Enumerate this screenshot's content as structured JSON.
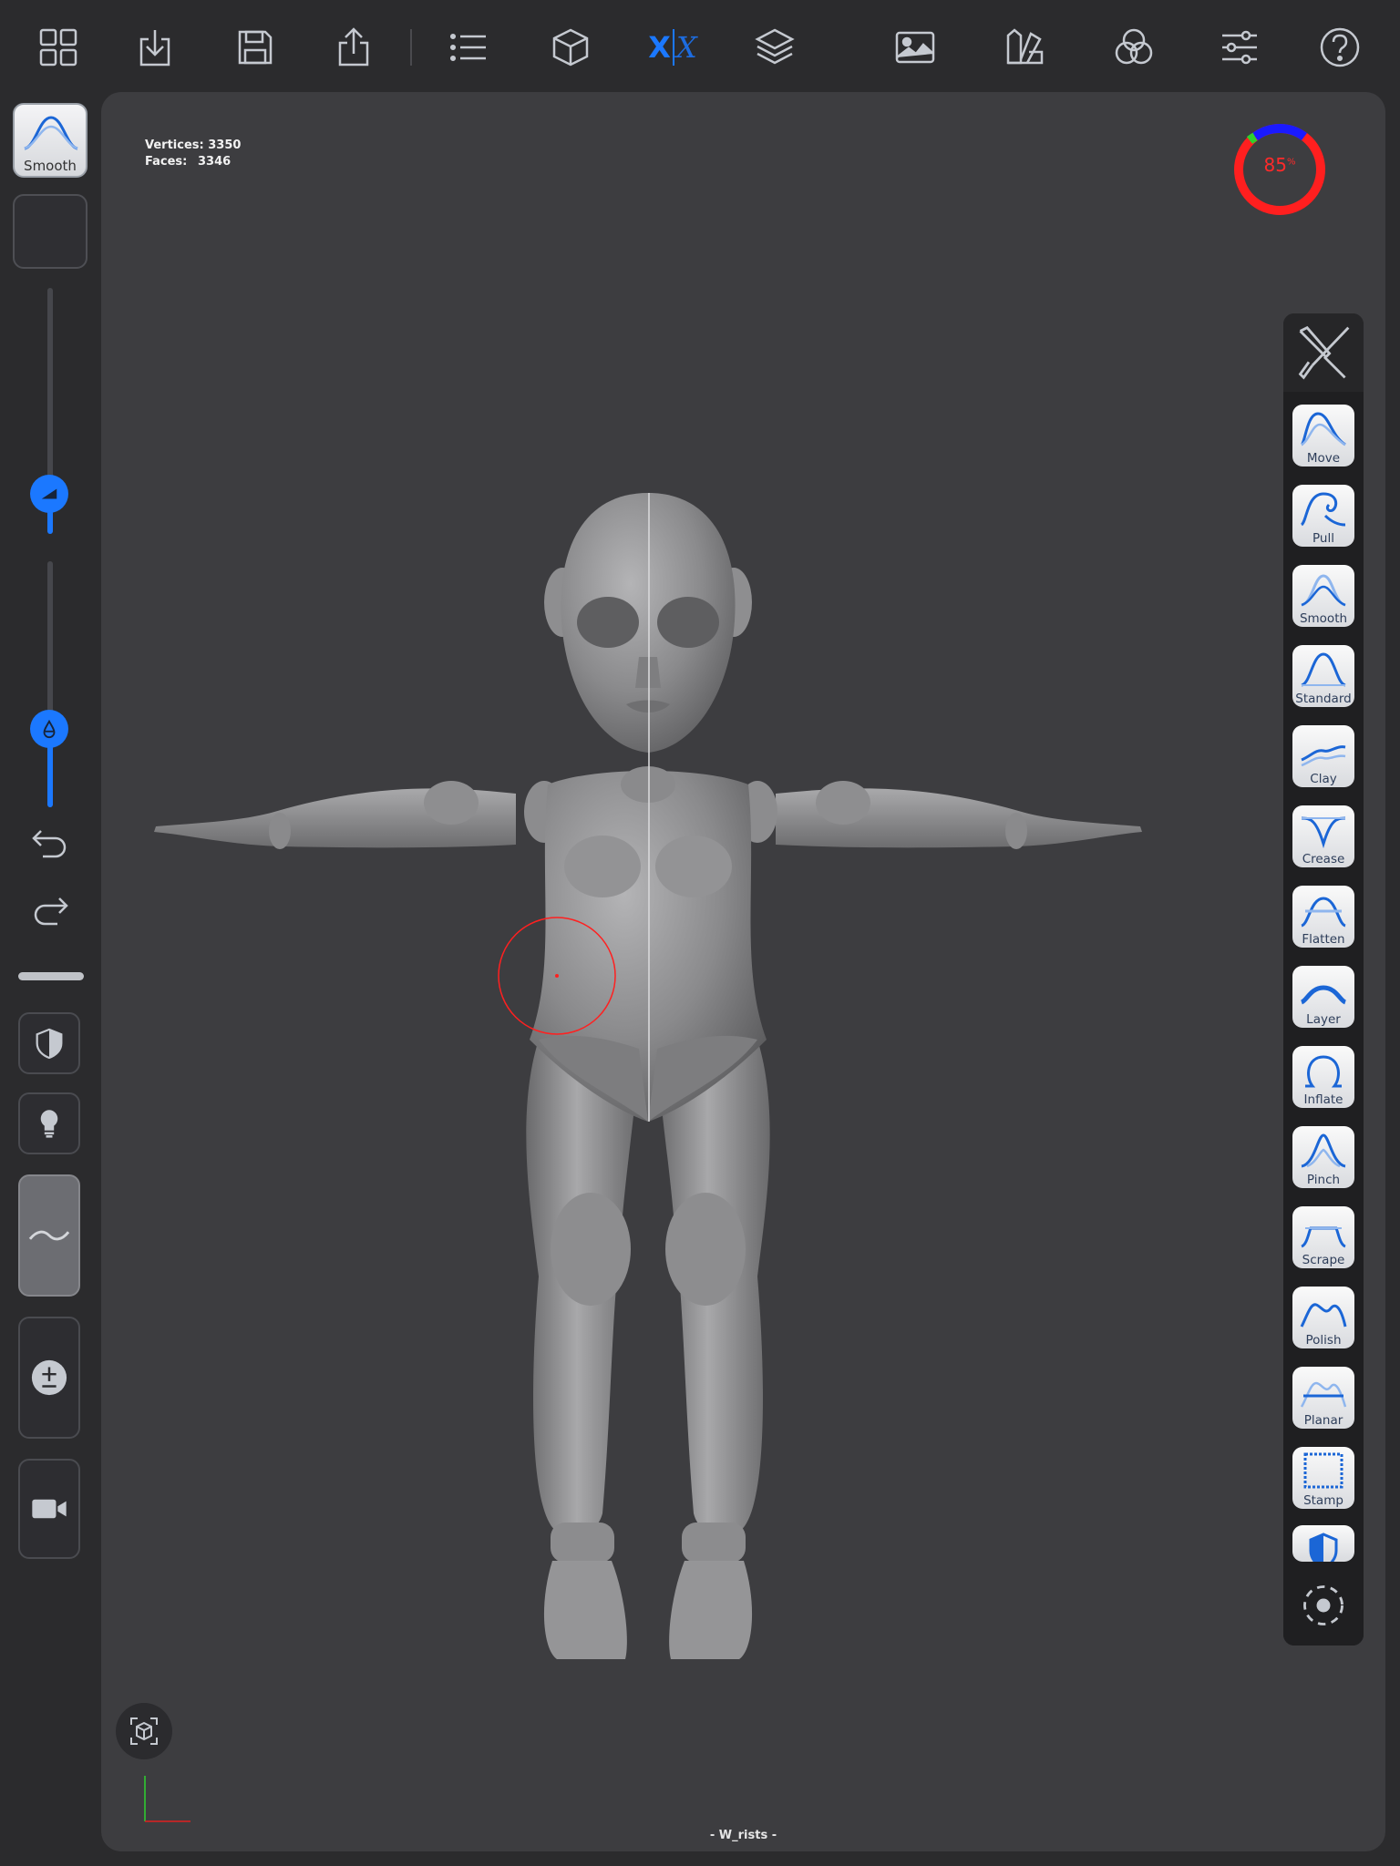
{
  "toolbar": {
    "icons": [
      "grid-icon",
      "import-icon",
      "save-icon",
      "share-icon",
      "list-icon",
      "cube-icon",
      "symmetry-icon",
      "layers-icon",
      "image-icon",
      "paint-icon",
      "material-icon",
      "settings-icon",
      "help-icon"
    ],
    "symmetry_left": "X",
    "symmetry_right": "X",
    "accent": "#1b78ff"
  },
  "stats": {
    "vertices_label": "Vertices:",
    "vertices_value": "3350",
    "faces_label": "Faces:",
    "faces_value": "3346"
  },
  "memory": {
    "value": "85",
    "unit": "%",
    "fraction": 0.85,
    "color": "#ff1f1f"
  },
  "left_panel": {
    "active_tool_label": "Smooth",
    "radius_fraction": 0.2,
    "intensity_fraction": 0.33,
    "icons": [
      "undo-icon",
      "redo-icon",
      "mask-icon",
      "light-icon",
      "stroke-icon",
      "plus-minus-icon",
      "camera-icon"
    ]
  },
  "tools": [
    {
      "label": "Move"
    },
    {
      "label": "Pull"
    },
    {
      "label": "Smooth"
    },
    {
      "label": "Standard"
    },
    {
      "label": "Clay"
    },
    {
      "label": "Crease"
    },
    {
      "label": "Flatten"
    },
    {
      "label": "Layer"
    },
    {
      "label": "Inflate"
    },
    {
      "label": "Pinch"
    },
    {
      "label": "Scrape"
    },
    {
      "label": "Polish"
    },
    {
      "label": "Planar"
    },
    {
      "label": "Stamp"
    }
  ],
  "scene": {
    "object_name": "- W_rists -"
  }
}
